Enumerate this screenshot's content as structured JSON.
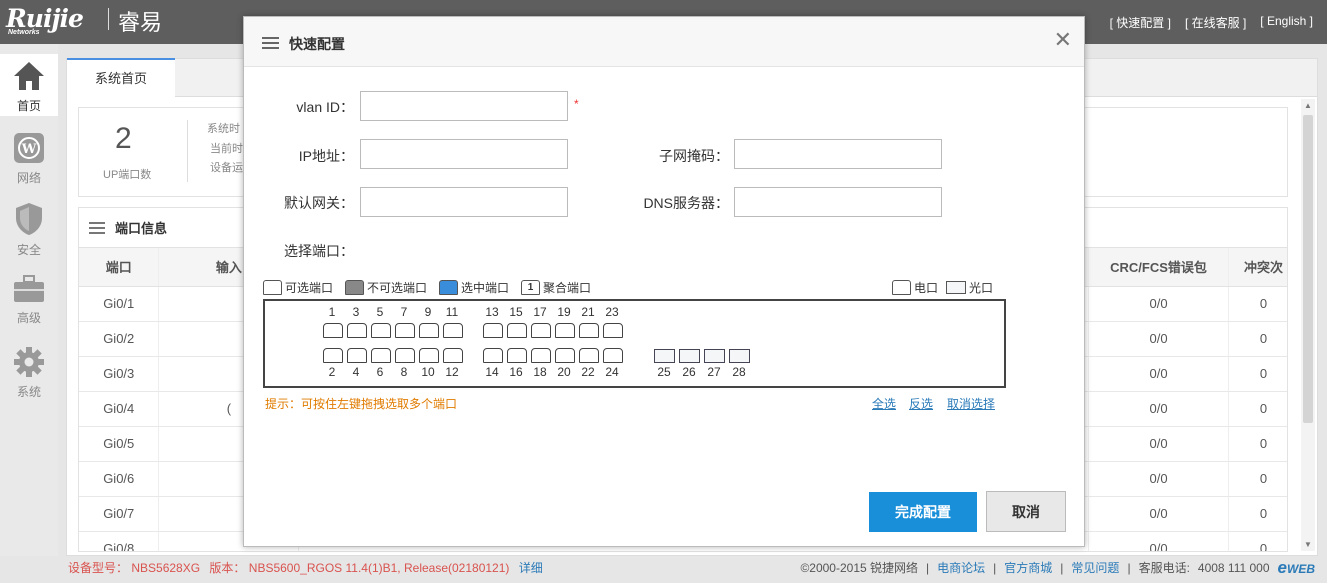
{
  "header": {
    "logo_text": "Ruijie",
    "logo_sub": "Networks",
    "brand": "睿易",
    "links": [
      "[ 快速配置 ]",
      "[ 在线客服 ]",
      "[ English ]"
    ]
  },
  "nav": [
    {
      "label": "首页",
      "icon": "home-icon"
    },
    {
      "label": "网络",
      "icon": "wordpress-icon"
    },
    {
      "label": "安全",
      "icon": "shield-icon"
    },
    {
      "label": "高级",
      "icon": "toolbox-icon"
    },
    {
      "label": "系统",
      "icon": "gear-icon"
    }
  ],
  "tab": {
    "home": "系统首页"
  },
  "stats": {
    "up_ports": "2",
    "up_ports_label": "UP端口数",
    "mini1": "系统时",
    "mini2": "当前时",
    "mini3": "设备运"
  },
  "ports_section": {
    "title": "端口信息",
    "columns": {
      "port": "端口",
      "input": "输入",
      "crc": "CRC/FCS错误包",
      "conflict": "冲突次"
    },
    "rows": [
      {
        "port": "Gi0/1",
        "input": "",
        "crc": "0/0",
        "conflict": "0"
      },
      {
        "port": "Gi0/2",
        "input": "",
        "crc": "0/0",
        "conflict": "0"
      },
      {
        "port": "Gi0/3",
        "input": "",
        "crc": "0/0",
        "conflict": "0"
      },
      {
        "port": "Gi0/4",
        "input": "(",
        "crc": "0/0",
        "conflict": "0"
      },
      {
        "port": "Gi0/5",
        "input": "",
        "crc": "0/0",
        "conflict": "0"
      },
      {
        "port": "Gi0/6",
        "input": "",
        "crc": "0/0",
        "conflict": "0"
      },
      {
        "port": "Gi0/7",
        "input": "",
        "crc": "0/0",
        "conflict": "0"
      },
      {
        "port": "Gi0/8",
        "input": "",
        "crc": "0/0",
        "conflict": "0"
      }
    ]
  },
  "footer": {
    "model_label": "设备型号：",
    "model": "NBS5628XG",
    "version_label": "版本：",
    "version": "NBS5600_RGOS 11.4(1)B1, Release(02180121)",
    "detail": "详细",
    "copyright": "©2000-2015 锐捷网络",
    "links": [
      "电商论坛",
      "官方商城",
      "常见问题"
    ],
    "phone_label": "客服电话:",
    "phone": "4008 111 000",
    "eweb": "WEB"
  },
  "modal": {
    "title": "快速配置",
    "vlan_label": "vlan ID：",
    "vlan_value": "",
    "ip_label": "IP地址：",
    "ip_value": "",
    "mask_label": "子网掩码：",
    "mask_value": "",
    "gw_label": "默认网关：",
    "gw_value": "",
    "dns_label": "DNS服务器：",
    "dns_value": "",
    "port_select_label": "选择端口：",
    "required_mark": "*",
    "legend": {
      "selectable": "可选端口",
      "unselectable": "不可选端口",
      "selected": "选中端口",
      "aggregate": "聚合端口",
      "aggregate_num": "1",
      "electric": "电口",
      "optical": "光口"
    },
    "ports_top": [
      "1",
      "3",
      "5",
      "7",
      "9",
      "11",
      "13",
      "15",
      "17",
      "19",
      "21",
      "23"
    ],
    "ports_bottom": [
      "2",
      "4",
      "6",
      "8",
      "10",
      "12",
      "14",
      "16",
      "18",
      "20",
      "22",
      "24"
    ],
    "fiber_ports": [
      "25",
      "26",
      "27",
      "28"
    ],
    "hint": "提示：可按住左键拖拽选取多个端口",
    "select_all": "全选",
    "invert": "反选",
    "clear": "取消选择",
    "ok": "完成配置",
    "cancel": "取消",
    "colors": {
      "primary": "#1a8fd9",
      "selected_port": "#3a8ddb",
      "unselectable_port": "#888888",
      "required": "#ee3333",
      "hint": "#e07b00"
    }
  }
}
